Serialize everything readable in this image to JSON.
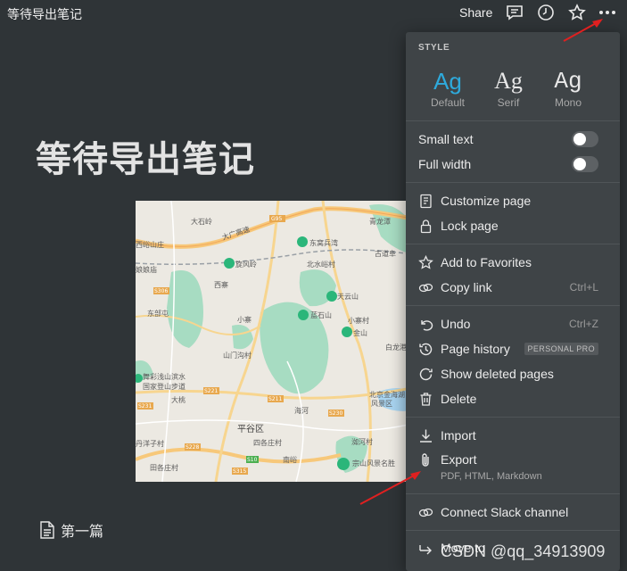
{
  "topbar": {
    "breadcrumb": "等待导出笔记",
    "share_label": "Share"
  },
  "page": {
    "title": "等待导出笔记",
    "sub_page": "第一篇"
  },
  "map": {
    "labels": [
      "大石岭",
      "青龙潭",
      "西峪山庄",
      "大广高速",
      "东窝兵湾",
      "旋风岭",
      "北水峪村",
      "古道阜",
      "娘娘庙",
      "西寨",
      "东部屯",
      "小寨",
      "天云山",
      "小寨村",
      "蓝石山",
      "金山",
      "山门沟村",
      "白龙港",
      "舞彩浅山滨水",
      "国家登山步道",
      "北京金海湖",
      "风景区",
      "平谷区",
      "大桃",
      "海河",
      "洳河村",
      "丹洋子村",
      "田各庄村",
      "四各庄村",
      "南峪",
      "宗山风景名胜"
    ],
    "road_shields": [
      "G95",
      "S306",
      "S221",
      "S211",
      "S231",
      "S230",
      "S228",
      "S315",
      "S10",
      "G230"
    ]
  },
  "menu": {
    "style_header": "STYLE",
    "fonts": [
      {
        "glyph": "Ag",
        "name": "Default",
        "active": true
      },
      {
        "glyph": "Ag",
        "name": "Serif",
        "active": false
      },
      {
        "glyph": "Ag",
        "name": "Mono",
        "active": false
      }
    ],
    "small_text": "Small text",
    "full_width": "Full width",
    "small_text_on": false,
    "full_width_on": false,
    "customize_page": "Customize page",
    "lock_page": "Lock page",
    "add_to_favorites": "Add to Favorites",
    "copy_link": "Copy link",
    "copy_link_shortcut": "Ctrl+L",
    "undo": "Undo",
    "undo_shortcut": "Ctrl+Z",
    "page_history": "Page history",
    "page_history_badge": "PERSONAL PRO",
    "show_deleted": "Show deleted pages",
    "delete": "Delete",
    "import": "Import",
    "export": "Export",
    "export_formats": "PDF, HTML, Markdown",
    "connect_slack": "Connect Slack channel",
    "move_to": "Move to"
  },
  "watermark": "CSDN @qq_34913909",
  "colors": {
    "background": "#2f3437",
    "menu": "#3f4447",
    "accent": "#2eaadc",
    "arrow": "#e02020"
  }
}
